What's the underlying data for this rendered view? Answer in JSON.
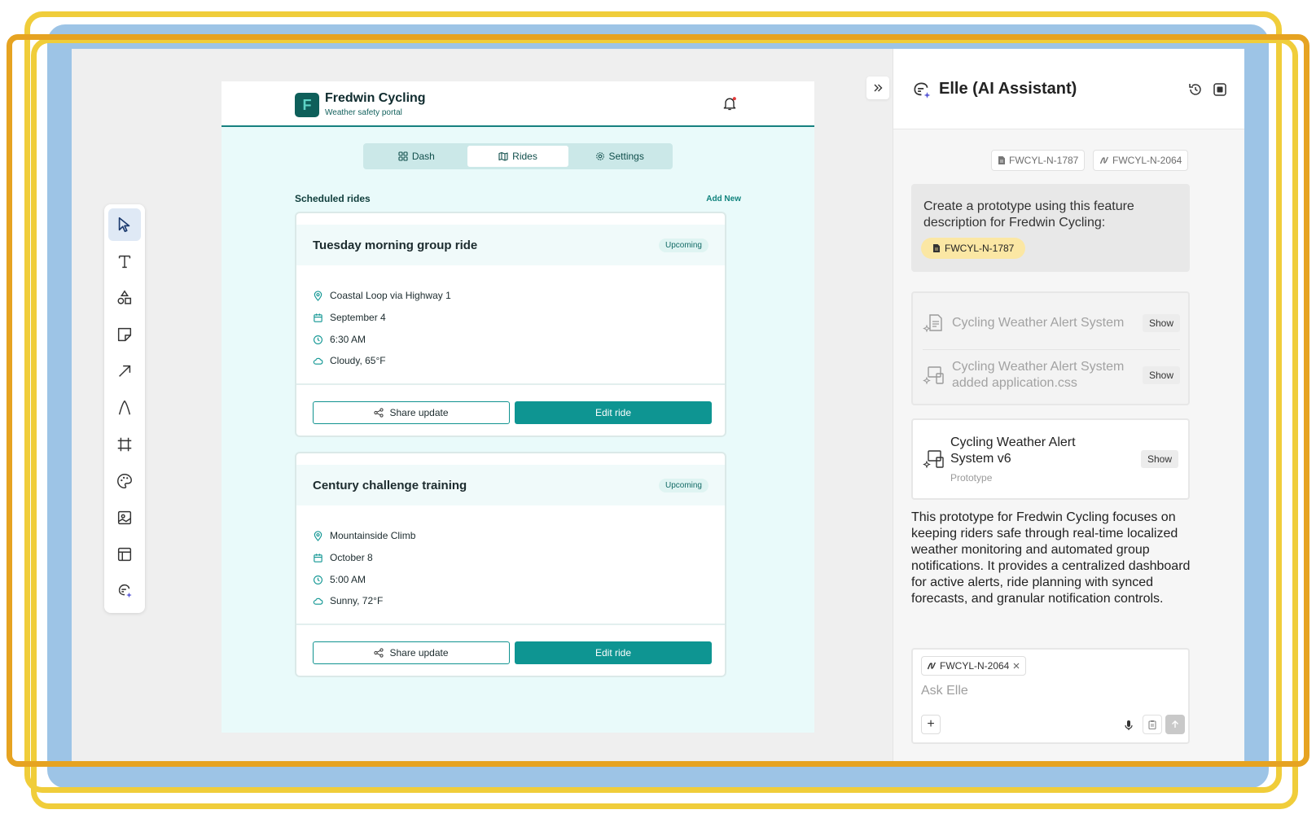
{
  "app": {
    "brand_name": "Fredwin Cycling",
    "brand_sub": "Weather safety portal",
    "logo_letter": "F",
    "tabs": [
      {
        "label": "Dash",
        "icon": "grid-icon"
      },
      {
        "label": "Rides",
        "icon": "map-icon"
      },
      {
        "label": "Settings",
        "icon": "gear-icon"
      }
    ],
    "section_title": "Scheduled rides",
    "add_new": "Add New",
    "rides": [
      {
        "title": "Tuesday morning group ride",
        "status": "Upcoming",
        "route": "Coastal Loop via Highway 1",
        "date": "September 4",
        "time": "6:30 AM",
        "weather": "Cloudy, 65°F",
        "share_label": "Share update",
        "edit_label": "Edit ride"
      },
      {
        "title": "Century challenge training",
        "status": "Upcoming",
        "route": "Mountainside Climb",
        "date": "October 8",
        "time": "5:00 AM",
        "weather": "Sunny, 72°F",
        "share_label": "Share update",
        "edit_label": "Edit ride"
      }
    ]
  },
  "assistant": {
    "title": "Elle (AI Assistant)",
    "refs": [
      "FWCYL-N-1787",
      "FWCYL-N-2064"
    ],
    "prompt_text": "Create a prototype using this feature description for Fredwin Cycling:",
    "prompt_chip": "FWCYL-N-1787",
    "files": [
      {
        "name": "Cycling Weather Alert System",
        "show": "Show"
      },
      {
        "name": "Cycling Weather Alert System added application.css",
        "show": "Show"
      }
    ],
    "prototype": {
      "name": "Cycling Weather Alert System v6",
      "sub": "Prototype",
      "show": "Show"
    },
    "description": "This prototype for Fredwin Cycling focuses on keeping riders safe through real-time localized weather monitoring and automated group notifications. It provides a centralized dashboard for active alerts, ride planning with synced forecasts, and granular notification controls.",
    "input_chip": "FWCYL-N-2064",
    "input_placeholder": "Ask Elle",
    "plus": "+"
  },
  "colors": {
    "teal": "#0e9592",
    "brand_dark": "#0e5f5a",
    "app_bg": "#e9fafa",
    "frame_yellow": "#f0cd3a",
    "frame_orange": "#e6a321",
    "frame_blue": "#9dc4e6"
  }
}
